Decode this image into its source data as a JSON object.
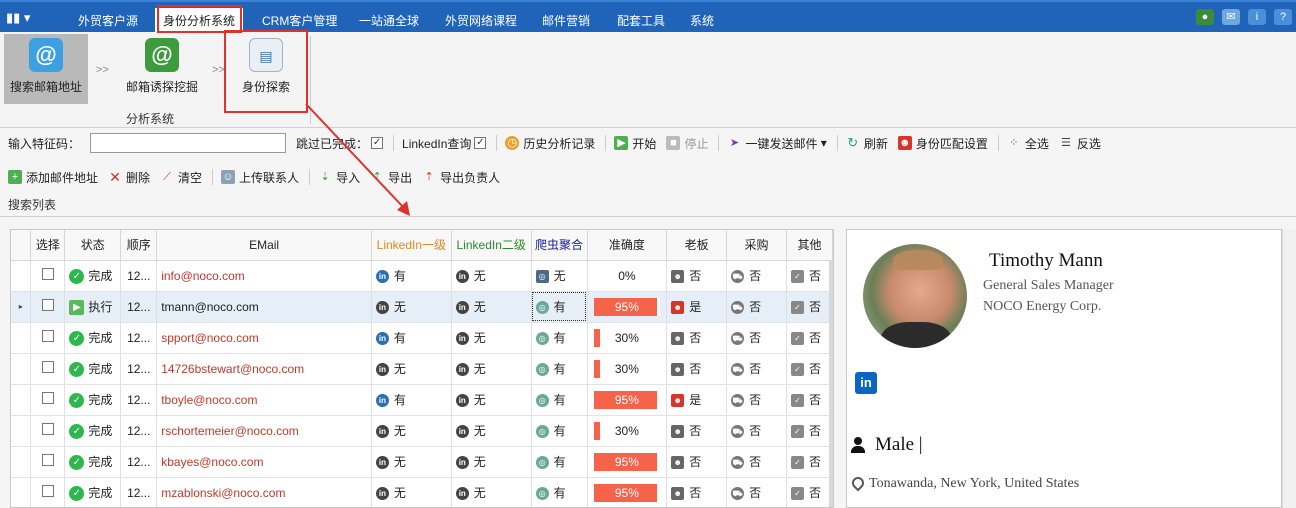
{
  "menubar": {
    "items": [
      "外贸客户源",
      "身份分析系统",
      "CRM客户管理",
      "一站通全球",
      "外贸网络课程",
      "邮件营销",
      "配套工具",
      "系统"
    ],
    "active_index": 1
  },
  "ribbon": {
    "buttons": [
      {
        "label": "搜索邮箱地址",
        "icon": "email-at-icon",
        "selected": true
      },
      {
        "label": "邮箱诱探挖掘",
        "icon": "email-at-green-icon",
        "selected": false
      },
      {
        "label": "身份探索",
        "icon": "identity-card-icon",
        "selected": false
      }
    ],
    "separator": ">>",
    "group_label": "分析系统"
  },
  "toolbar1": {
    "feature_code_label": "输入特征码：",
    "feature_code_value": "",
    "skip_completed_label": "跳过已完成：",
    "linkedin_query_label": "LinkedIn查询",
    "history_label": "历史分析记录",
    "start_label": "开始",
    "stop_label": "停止",
    "send_mail_label": "一键发送邮件",
    "refresh_label": "刷新",
    "identity_match_label": "身份匹配设置",
    "select_all_label": "全选",
    "invert_label": "反选"
  },
  "toolbar2": {
    "add_email_label": "添加邮件地址",
    "delete_label": "删除",
    "clear_label": "清空",
    "upload_label": "上传联系人",
    "import_label": "导入",
    "export_label": "导出",
    "export_owner_label": "导出负责人"
  },
  "list": {
    "section_title": "搜索列表",
    "columns": [
      "选择",
      "状态",
      "顺序",
      "EMail",
      "LinkedIn一级",
      "LinkedIn二级",
      "爬虫聚合",
      "准确度",
      "老板",
      "采购",
      "其他"
    ],
    "column_colors": {
      "linkedin1": "#e08a1e",
      "linkedin2": "#2a8a2a",
      "crawler": "#1a1aa0"
    },
    "rows": [
      {
        "status": "完成",
        "order": "12...",
        "email": "info@noco.com",
        "li1": "有",
        "li2": "无",
        "crawl": "无",
        "accuracy": "0%",
        "acc_value": 0,
        "boss": "否",
        "buyer": "否",
        "other": "否",
        "selected": false,
        "running": false
      },
      {
        "status": "执行",
        "order": "12...",
        "email": "tmann@noco.com",
        "li1": "无",
        "li2": "无",
        "crawl": "有",
        "accuracy": "95%",
        "acc_value": 95,
        "boss": "是",
        "buyer": "否",
        "other": "否",
        "selected": true,
        "running": true
      },
      {
        "status": "完成",
        "order": "12...",
        "email": "spport@noco.com",
        "li1": "有",
        "li2": "无",
        "crawl": "有",
        "accuracy": "30%",
        "acc_value": 30,
        "boss": "否",
        "buyer": "否",
        "other": "否",
        "selected": false,
        "running": false
      },
      {
        "status": "完成",
        "order": "12...",
        "email": "14726bstewart@noco.com",
        "li1": "无",
        "li2": "无",
        "crawl": "有",
        "accuracy": "30%",
        "acc_value": 30,
        "boss": "否",
        "buyer": "否",
        "other": "否",
        "selected": false,
        "running": false
      },
      {
        "status": "完成",
        "order": "12...",
        "email": "tboyle@noco.com",
        "li1": "有",
        "li2": "无",
        "crawl": "有",
        "accuracy": "95%",
        "acc_value": 95,
        "boss": "是",
        "buyer": "否",
        "other": "否",
        "selected": false,
        "running": false
      },
      {
        "status": "完成",
        "order": "12...",
        "email": "rschortemeier@noco.com",
        "li1": "无",
        "li2": "无",
        "crawl": "有",
        "accuracy": "30%",
        "acc_value": 30,
        "boss": "否",
        "buyer": "否",
        "other": "否",
        "selected": false,
        "running": false
      },
      {
        "status": "完成",
        "order": "12...",
        "email": "kbayes@noco.com",
        "li1": "无",
        "li2": "无",
        "crawl": "有",
        "accuracy": "95%",
        "acc_value": 95,
        "boss": "否",
        "buyer": "否",
        "other": "否",
        "selected": false,
        "running": false
      },
      {
        "status": "完成",
        "order": "12...",
        "email": "mzablonski@noco.com",
        "li1": "无",
        "li2": "无",
        "crawl": "有",
        "accuracy": "95%",
        "acc_value": 95,
        "boss": "否",
        "buyer": "否",
        "other": "否",
        "selected": false,
        "running": false
      }
    ]
  },
  "profile": {
    "name": "Timothy Mann",
    "title": "General Sales Manager",
    "company": "NOCO Energy Corp.",
    "linkedin_badge": "in",
    "gender": "Male |",
    "location": "Tonawanda, New York, United States"
  },
  "colors": {
    "menubar_bg": "#1f64b8",
    "accuracy_fill": "#f4634a",
    "annotation_red": "#e0322d",
    "linkedin_blue": "#0a66c2"
  }
}
